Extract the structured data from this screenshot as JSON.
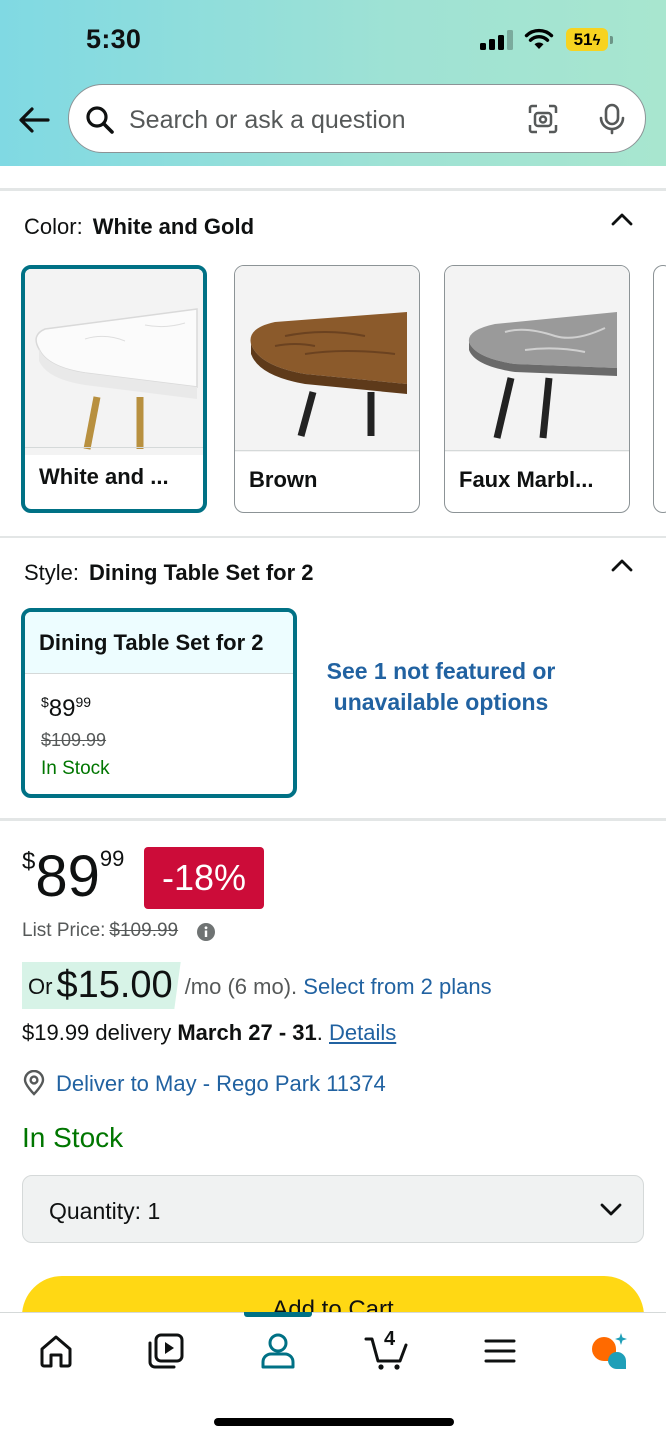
{
  "status_bar": {
    "time": "5:30",
    "battery": "51"
  },
  "search": {
    "placeholder": "Search or ask a question"
  },
  "color_section": {
    "label": "Color:",
    "value": "White and Gold",
    "options": [
      {
        "label": "White and ...",
        "selected": true
      },
      {
        "label": "Brown",
        "selected": false
      },
      {
        "label": "Faux Marbl...",
        "selected": false
      }
    ]
  },
  "style_section": {
    "label": "Style:",
    "value": "Dining Table Set for 2",
    "card": {
      "title": "Dining Table Set for 2",
      "price_symbol": "$",
      "price_whole": "89",
      "price_cents": "99",
      "list_price": "$109.99",
      "stock": "In Stock"
    },
    "see_more": "See 1 not featured or unavailable options"
  },
  "price": {
    "symbol": "$",
    "whole": "89",
    "cents": "99",
    "discount": "-18%",
    "list_price_label": "List Price:",
    "list_price": "$109.99"
  },
  "monthly": {
    "or": "or",
    "amount": "$15.00",
    "suffix": "/mo (6 mo).",
    "plans_link": "Select from 2 plans"
  },
  "delivery": {
    "prefix": "$19.99 delivery",
    "dates": "March 27 - 31",
    "suffix": ".",
    "details": "Details"
  },
  "deliver_to": "Deliver to May - Rego Park 11374",
  "stock_status": "In Stock",
  "quantity": {
    "label": "Quantity:",
    "value": "1"
  },
  "add_to_cart": "Add to Cart",
  "nav": {
    "cart_count": "4",
    "items": [
      "home",
      "video",
      "account",
      "cart",
      "menu",
      "rufus"
    ],
    "active": "account"
  },
  "colors": {
    "accent": "#007185",
    "link": "#2162a1",
    "deal_red": "#cc0c39",
    "stock_green": "#007600",
    "cart_yellow": "#ffd814"
  }
}
